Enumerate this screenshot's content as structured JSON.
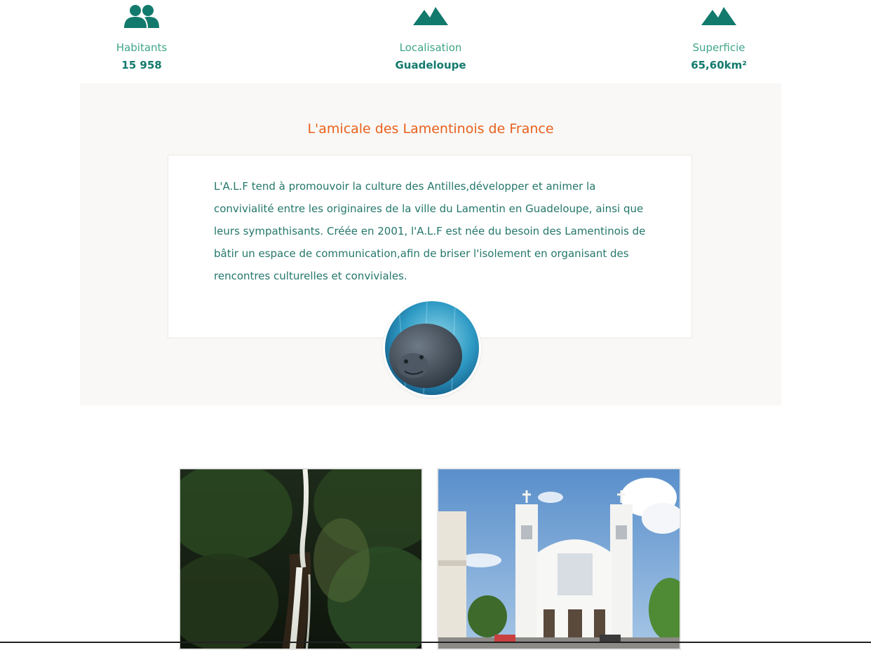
{
  "stats": [
    {
      "icon": "people-icon",
      "label": "Habitants",
      "value": "15 958"
    },
    {
      "icon": "mountain-icon",
      "label": "Localisation",
      "value": "Guadeloupe"
    },
    {
      "icon": "mountain-icon",
      "label": "Superficie",
      "value": "65,60km²"
    }
  ],
  "about": {
    "title": "L'amicale des Lamentinois de France",
    "text": "L'A.L.F tend à promouvoir la culture des Antilles,développer et animer la convivialité entre les originaires de la ville du Lamentin en Guadeloupe, ainsi que leurs sympathisants. Créée en 2001, l'A.L.F est née du besoin des Lamentinois de bâtir un espace de communication,afin de briser l'isolement en organisant des rencontres culturelles et conviviales."
  },
  "colors": {
    "accent": "#127a6d",
    "label": "#3fa589",
    "title": "#e8601c",
    "section_bg": "#f9f8f6"
  }
}
